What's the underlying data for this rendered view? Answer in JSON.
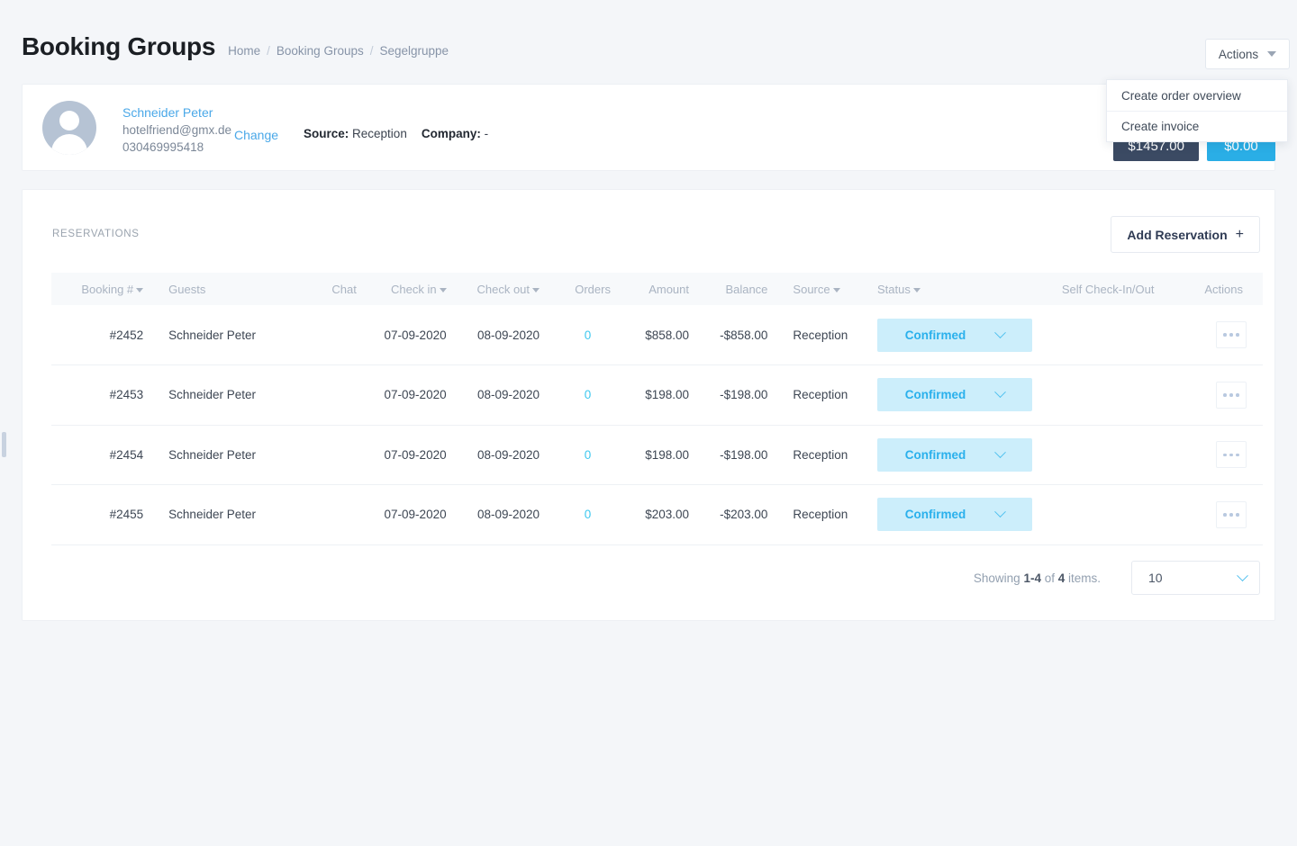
{
  "header": {
    "title": "Booking Groups",
    "breadcrumbs": [
      "Home",
      "Booking Groups",
      "Segelgruppe"
    ],
    "separator": "/"
  },
  "actions": {
    "button_label": "Actions",
    "menu_items": [
      "Create order overview",
      "Create invoice"
    ],
    "menu_open": true
  },
  "guest": {
    "name": "Schneider Peter",
    "email": "hotelfriend@gmx.de",
    "phone": "030469995418",
    "change_label": "Change",
    "source_label": "Source:",
    "source_value": "Reception",
    "company_label": "Company:",
    "company_value": "-",
    "badges": [
      {
        "text": "$1457.00",
        "color": "#3b4a63"
      },
      {
        "text": "$0.00",
        "color": "#2aaee6"
      }
    ]
  },
  "reservations": {
    "section_label": "RESERVATIONS",
    "add_button_label": "Add Reservation",
    "add_button_icon": "plus-icon",
    "columns": [
      {
        "key": "booking",
        "label": "Booking #",
        "sortable": true
      },
      {
        "key": "guests",
        "label": "Guests",
        "sortable": false
      },
      {
        "key": "chat",
        "label": "Chat",
        "sortable": false
      },
      {
        "key": "checkin",
        "label": "Check in",
        "sortable": true
      },
      {
        "key": "checkout",
        "label": "Check out",
        "sortable": true
      },
      {
        "key": "orders",
        "label": "Orders",
        "sortable": false
      },
      {
        "key": "amount",
        "label": "Amount",
        "sortable": false
      },
      {
        "key": "balance",
        "label": "Balance",
        "sortable": false
      },
      {
        "key": "source",
        "label": "Source",
        "sortable": true
      },
      {
        "key": "status",
        "label": "Status",
        "sortable": true
      },
      {
        "key": "self",
        "label": "Self Check-In/Out",
        "sortable": false
      },
      {
        "key": "actions",
        "label": "Actions",
        "sortable": false
      }
    ],
    "rows": [
      {
        "booking": "#2452",
        "guests": "Schneider Peter",
        "chat": "",
        "checkin": "07-09-2020",
        "checkout": "08-09-2020",
        "orders": "0",
        "amount": "$858.00",
        "balance": "-$858.00",
        "source": "Reception",
        "status": "Confirmed",
        "self": "",
        "actions": "more-options-icon"
      },
      {
        "booking": "#2453",
        "guests": "Schneider Peter",
        "chat": "",
        "checkin": "07-09-2020",
        "checkout": "08-09-2020",
        "orders": "0",
        "amount": "$198.00",
        "balance": "-$198.00",
        "source": "Reception",
        "status": "Confirmed",
        "self": "",
        "actions": "more-options-icon"
      },
      {
        "booking": "#2454",
        "guests": "Schneider Peter",
        "chat": "",
        "checkin": "07-09-2020",
        "checkout": "08-09-2020",
        "orders": "0",
        "amount": "$198.00",
        "balance": "-$198.00",
        "source": "Reception",
        "status": "Confirmed",
        "self": "",
        "actions": "more-options-icon"
      },
      {
        "booking": "#2455",
        "guests": "Schneider Peter",
        "chat": "",
        "checkin": "07-09-2020",
        "checkout": "08-09-2020",
        "orders": "0",
        "amount": "$203.00",
        "balance": "-$203.00",
        "source": "Reception",
        "status": "Confirmed",
        "self": "",
        "actions": "more-options-icon"
      }
    ],
    "footer": {
      "showing_prefix": "Showing ",
      "showing_range": "1-4",
      "showing_middle": " of ",
      "showing_total": "4",
      "showing_suffix": " items.",
      "per_page_value": "10"
    }
  },
  "colors": {
    "page_bg": "#f4f6f9",
    "accent_blue": "#2aaee6",
    "status_pill_bg": "#cceefb",
    "status_pill_text": "#2ab0ec",
    "badge_dark": "#3b4a63",
    "link": "#4aa8e8"
  }
}
